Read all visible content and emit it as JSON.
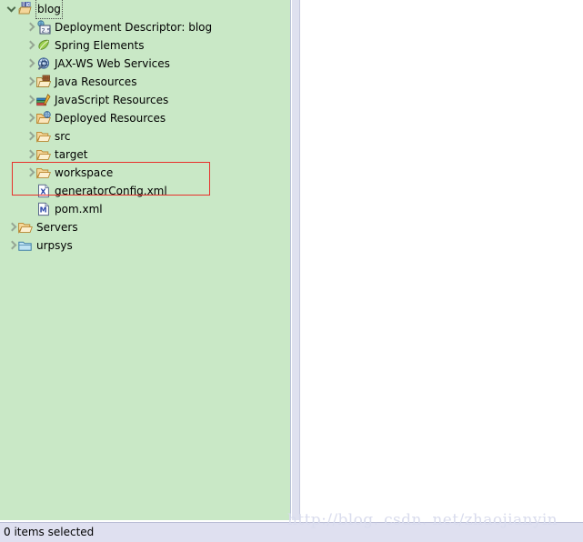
{
  "panel": {
    "name": "project-explorer",
    "background_color": "#c9e8c6",
    "scrollbar_color": "#dfe1ef"
  },
  "tree": {
    "rows": [
      {
        "label": "blog",
        "icon": "project-web-icon",
        "twisty": "expanded",
        "indent": 0,
        "focused": true
      },
      {
        "label": "Deployment Descriptor: blog",
        "icon": "deployment-descriptor-icon",
        "twisty": "collapsed",
        "indent": 1,
        "focused": false
      },
      {
        "label": "Spring Elements",
        "icon": "spring-leaf-icon",
        "twisty": "collapsed",
        "indent": 1,
        "focused": false
      },
      {
        "label": "JAX-WS Web Services",
        "icon": "jaxws-globe-icon",
        "twisty": "collapsed",
        "indent": 1,
        "focused": false
      },
      {
        "label": "Java Resources",
        "icon": "java-resources-folder-icon",
        "twisty": "collapsed",
        "indent": 1,
        "focused": false
      },
      {
        "label": "JavaScript Resources",
        "icon": "javascript-resources-icon",
        "twisty": "collapsed",
        "indent": 1,
        "focused": false
      },
      {
        "label": "Deployed Resources",
        "icon": "deployed-resources-icon",
        "twisty": "collapsed",
        "indent": 1,
        "focused": false
      },
      {
        "label": "src",
        "icon": "folder-open-icon",
        "twisty": "collapsed",
        "indent": 1,
        "focused": false
      },
      {
        "label": "target",
        "icon": "folder-open-icon",
        "twisty": "collapsed",
        "indent": 1,
        "focused": false
      },
      {
        "label": "workspace",
        "icon": "folder-open-icon",
        "twisty": "collapsed",
        "indent": 1,
        "focused": false
      },
      {
        "label": "generatorConfig.xml",
        "icon": "xml-file-icon",
        "twisty": "none",
        "indent": 1,
        "focused": false
      },
      {
        "label": "pom.xml",
        "icon": "maven-pom-file-icon",
        "twisty": "none",
        "indent": 1,
        "focused": false
      },
      {
        "label": "Servers",
        "icon": "folder-open-icon",
        "twisty": "collapsed",
        "indent": 0,
        "focused": false
      },
      {
        "label": "urpsys",
        "icon": "folder-closed-blue-icon",
        "twisty": "collapsed",
        "indent": 0,
        "focused": false
      }
    ]
  },
  "annotation": {
    "color": "#e8302a",
    "covers": [
      "workspace",
      "generatorConfig.xml"
    ]
  },
  "status": {
    "text": "0 items selected"
  },
  "watermark": {
    "text": "http://blog. csdn. net/zhaojianyin",
    "color": "#d9dced"
  }
}
